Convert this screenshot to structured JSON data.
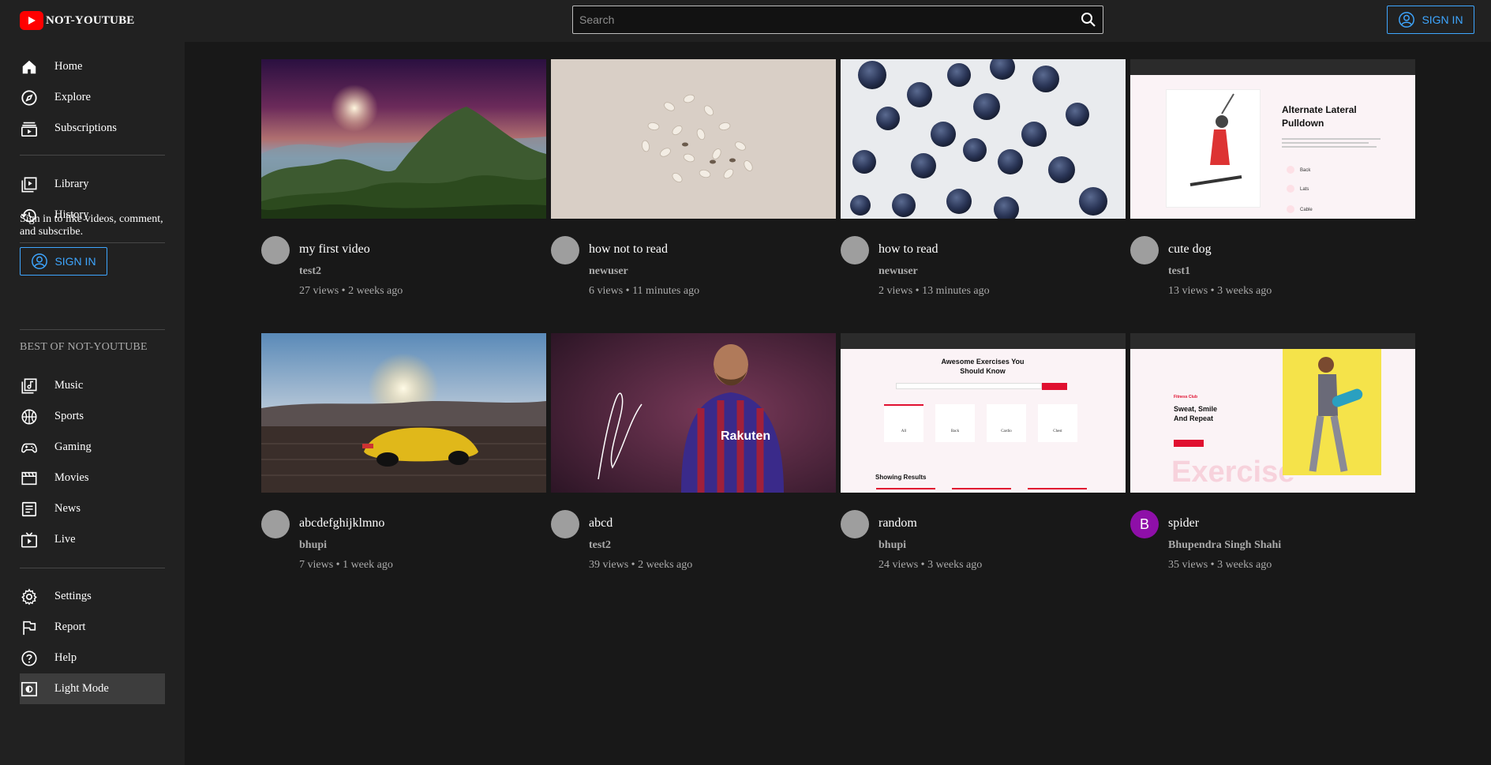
{
  "app": {
    "brand": "NOT-YOUTUBE",
    "brand_color": "#ff0000",
    "accent": "#3ea6ff"
  },
  "header": {
    "search_placeholder": "Search",
    "signin_label": "SIGN IN"
  },
  "sidebar": {
    "primary": [
      {
        "label": "Home",
        "icon": "home-icon"
      },
      {
        "label": "Explore",
        "icon": "compass-icon"
      },
      {
        "label": "Subscriptions",
        "icon": "subscriptions-icon"
      }
    ],
    "secondary": [
      {
        "label": "Library",
        "icon": "library-icon"
      },
      {
        "label": "History",
        "icon": "history-icon"
      }
    ],
    "signin_prompt": "Sign in to like videos, comment, and subscribe.",
    "signin_label": "SIGN IN",
    "best_title": "BEST OF NOT-YOUTUBE",
    "best": [
      {
        "label": "Music",
        "icon": "music-icon"
      },
      {
        "label": "Sports",
        "icon": "sports-icon"
      },
      {
        "label": "Gaming",
        "icon": "gaming-icon"
      },
      {
        "label": "Movies",
        "icon": "movies-icon"
      },
      {
        "label": "News",
        "icon": "news-icon"
      },
      {
        "label": "Live",
        "icon": "live-icon"
      }
    ],
    "footer": [
      {
        "label": "Settings",
        "icon": "gear-icon"
      },
      {
        "label": "Report",
        "icon": "flag-icon"
      },
      {
        "label": "Help",
        "icon": "help-icon"
      },
      {
        "label": "Light Mode",
        "icon": "light-mode-icon",
        "active": true
      }
    ]
  },
  "videos": [
    {
      "title": "my first video",
      "channel": "test2",
      "meta": "27 views • 2 weeks ago",
      "avatar": ""
    },
    {
      "title": "how not to read",
      "channel": "newuser",
      "meta": "6 views • 11 minutes ago",
      "avatar": ""
    },
    {
      "title": "how to read",
      "channel": "newuser",
      "meta": "2 views • 13 minutes ago",
      "avatar": ""
    },
    {
      "title": "cute dog",
      "channel": "test1",
      "meta": "13 views • 3 weeks ago",
      "avatar": ""
    },
    {
      "title": "abcdefghijklmno",
      "channel": "bhupi",
      "meta": "7 views • 1 week ago",
      "avatar": ""
    },
    {
      "title": "abcd",
      "channel": "test2",
      "meta": "39 views • 2 weeks ago",
      "avatar": ""
    },
    {
      "title": "random",
      "channel": "bhupi",
      "meta": "24 views • 3 weeks ago",
      "avatar": ""
    },
    {
      "title": "spider",
      "channel": "Bhupendra Singh Shahi",
      "meta": "35 views • 3 weeks ago",
      "avatar": "B"
    }
  ],
  "thumb_text": {
    "t4": {
      "title": "Alternate Lateral Pulldown",
      "items": [
        "Back",
        "Lats",
        "Cable"
      ]
    },
    "t7": {
      "title": "Awesome Exercises You Should Know",
      "results": "Showing Results",
      "cats": [
        "All",
        "Back",
        "Cardio",
        "Chest"
      ]
    },
    "t8": {
      "tag": "Fitness Club",
      "headline": "Sweat, Smile And Repeat",
      "watermark": "Exercise"
    },
    "t6": {
      "jersey": "Rakuten"
    }
  }
}
